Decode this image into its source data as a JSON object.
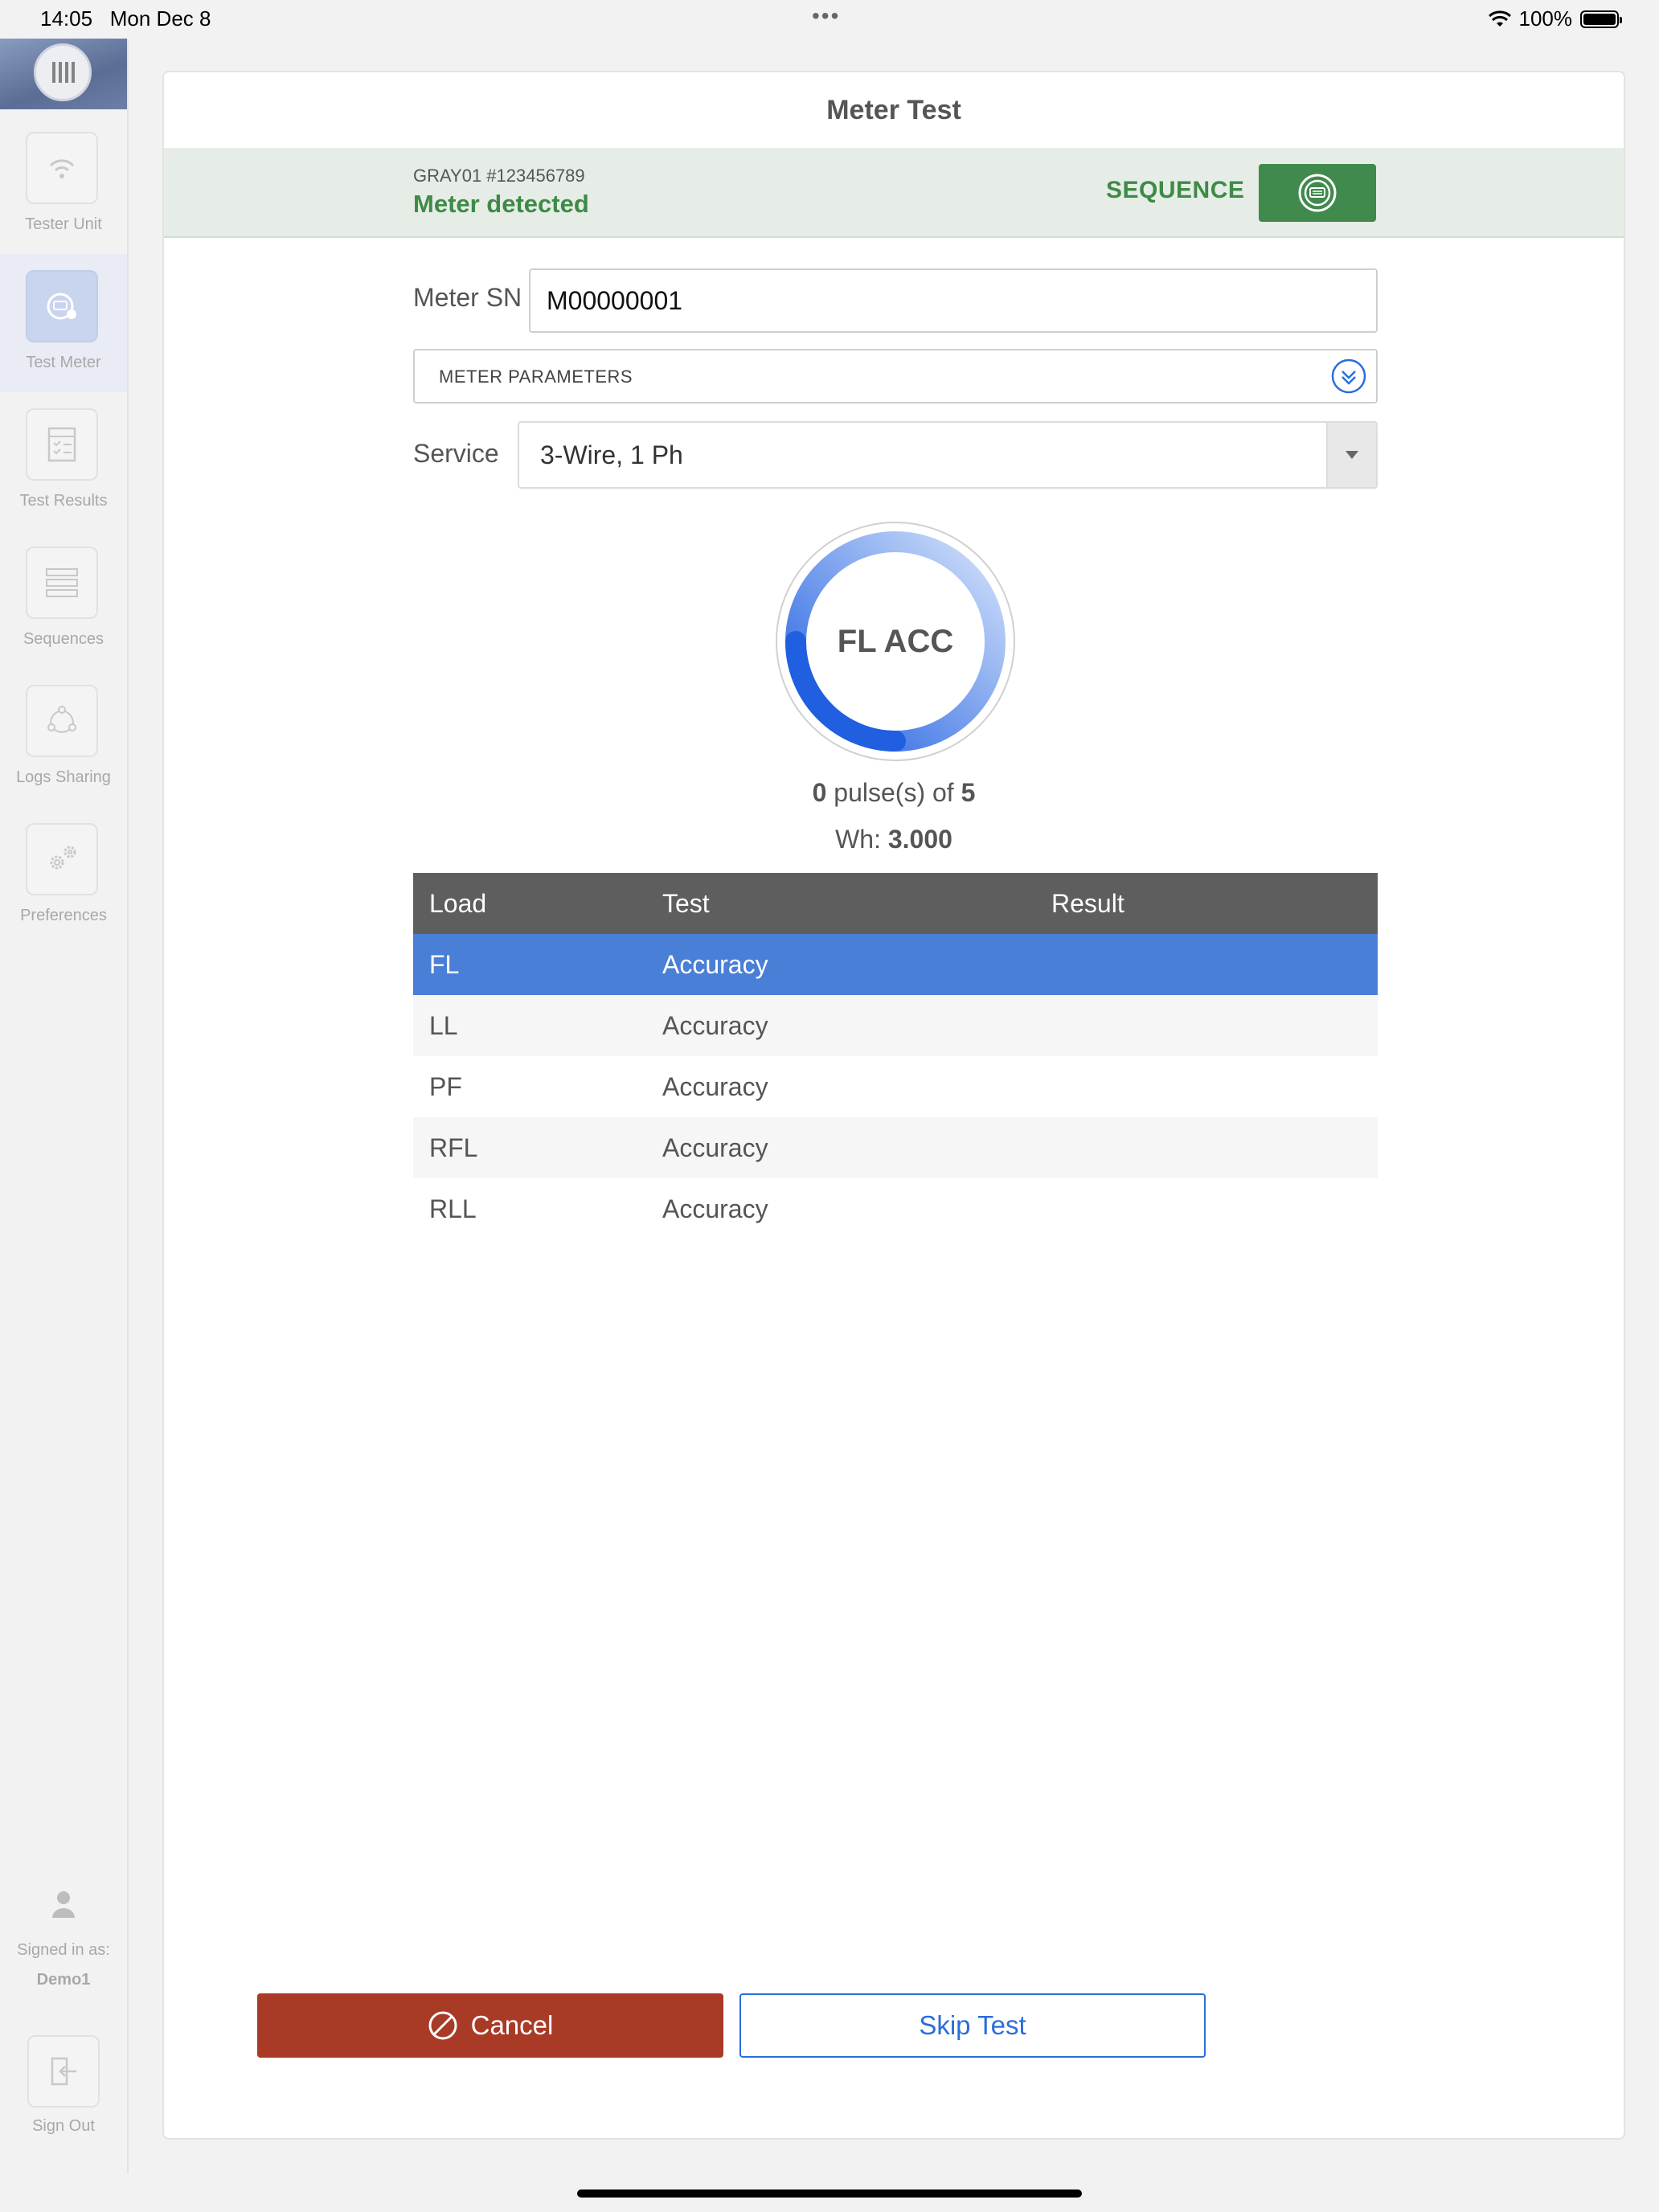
{
  "status_bar": {
    "time": "14:05",
    "date": "Mon Dec 8",
    "battery": "100%"
  },
  "sidebar": {
    "items": [
      {
        "label": "Tester Unit",
        "icon": "wifi-icon",
        "active": false
      },
      {
        "label": "Test Meter",
        "icon": "meter-icon",
        "active": true
      },
      {
        "label": "Test Results",
        "icon": "checklist-icon",
        "active": false
      },
      {
        "label": "Sequences",
        "icon": "sequence-list-icon",
        "active": false
      },
      {
        "label": "Logs Sharing",
        "icon": "share-icon",
        "active": false
      },
      {
        "label": "Preferences",
        "icon": "gears-icon",
        "active": false
      }
    ],
    "signed_in_label": "Signed in as:",
    "signed_in_user": "Demo1",
    "sign_out_label": "Sign Out"
  },
  "card": {
    "title": "Meter Test",
    "banner": {
      "device_id": "GRAY01 #123456789",
      "status": "Meter detected",
      "sequence_label": "SEQUENCE"
    },
    "meter_sn": {
      "label": "Meter SN",
      "value": "M00000001"
    },
    "meter_parameters_label": "METER PARAMETERS",
    "service": {
      "label": "Service",
      "value": "3-Wire, 1 Ph"
    },
    "gauge": {
      "label": "FL ACC",
      "progress": 0.25
    },
    "pulses": {
      "count": "0",
      "middle": " pulse(s) of ",
      "total": "5"
    },
    "wh": {
      "label": "Wh: ",
      "value": "3.000"
    },
    "table": {
      "headers": [
        "Load",
        "Test",
        "Result"
      ],
      "rows": [
        {
          "load": "FL",
          "test": "Accuracy",
          "result": ""
        },
        {
          "load": "LL",
          "test": "Accuracy",
          "result": ""
        },
        {
          "load": "PF",
          "test": "Accuracy",
          "result": ""
        },
        {
          "load": "RFL",
          "test": "Accuracy",
          "result": ""
        },
        {
          "load": "RLL",
          "test": "Accuracy",
          "result": ""
        }
      ]
    },
    "buttons": {
      "cancel": "Cancel",
      "skip": "Skip Test"
    }
  },
  "colors": {
    "accent_green": "#3e8a47",
    "selected_row": "#4a7fd8",
    "cancel": "#a93a26",
    "link_blue": "#2a6edb"
  }
}
